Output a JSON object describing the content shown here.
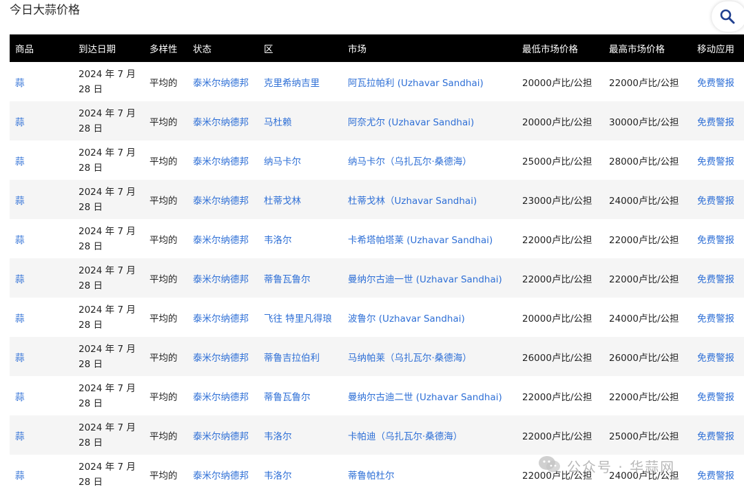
{
  "page": {
    "title": "今日大蒜价格",
    "search_icon": "search-icon"
  },
  "table": {
    "headers": [
      "商品",
      "到达日期",
      "多样性",
      "状态",
      "区",
      "市场",
      "最低市场价格",
      "最高市场价格",
      "移动应用"
    ],
    "rows": [
      {
        "commodity": "蒜",
        "date": "2024 年 7 月 28 日",
        "variety": "平均的",
        "state": "泰米尔纳德邦",
        "district": "克里希纳吉里",
        "market": "阿瓦拉帕利 (Uzhavar Sandhai)",
        "min": "20000卢比/公担",
        "max": "22000卢比/公担",
        "app": "免费警报"
      },
      {
        "commodity": "蒜",
        "date": "2024 年 7 月 28 日",
        "variety": "平均的",
        "state": "泰米尔纳德邦",
        "district": "马杜赖",
        "market": "阿奈尤尔 (Uzhavar Sandhai)",
        "min": "20000卢比/公担",
        "max": "30000卢比/公担",
        "app": "免费警报"
      },
      {
        "commodity": "蒜",
        "date": "2024 年 7 月 28 日",
        "variety": "平均的",
        "state": "泰米尔纳德邦",
        "district": "纳马卡尔",
        "market": "纳马卡尔（乌扎瓦尔·桑德海）",
        "min": "25000卢比/公担",
        "max": "28000卢比/公担",
        "app": "免费警报"
      },
      {
        "commodity": "蒜",
        "date": "2024 年 7 月 28 日",
        "variety": "平均的",
        "state": "泰米尔纳德邦",
        "district": "杜蒂戈林",
        "market": "杜蒂戈林（Uzhavar Sandhai)",
        "min": "23000卢比/公担",
        "max": "24000卢比/公担",
        "app": "免费警报"
      },
      {
        "commodity": "蒜",
        "date": "2024 年 7 月 28 日",
        "variety": "平均的",
        "state": "泰米尔纳德邦",
        "district": "韦洛尔",
        "market": "卡希塔帕塔莱 (Uzhavar Sandhai)",
        "min": "22000卢比/公担",
        "max": "22000卢比/公担",
        "app": "免费警报"
      },
      {
        "commodity": "蒜",
        "date": "2024 年 7 月 28 日",
        "variety": "平均的",
        "state": "泰米尔纳德邦",
        "district": "蒂鲁瓦鲁尔",
        "market": "曼纳尔古迪一世 (Uzhavar Sandhai)",
        "min": "22000卢比/公担",
        "max": "22000卢比/公担",
        "app": "免费警报"
      },
      {
        "commodity": "蒜",
        "date": "2024 年 7 月 28 日",
        "variety": "平均的",
        "state": "泰米尔纳德邦",
        "district": "飞往 特里凡得琅",
        "market": "波鲁尔 (Uzhavar Sandhai)",
        "min": "20000卢比/公担",
        "max": "24000卢比/公担",
        "app": "免费警报"
      },
      {
        "commodity": "蒜",
        "date": "2024 年 7 月 28 日",
        "variety": "平均的",
        "state": "泰米尔纳德邦",
        "district": "蒂鲁吉拉伯利",
        "market": "马纳帕莱（乌扎瓦尔·桑德海）",
        "min": "26000卢比/公担",
        "max": "26000卢比/公担",
        "app": "免费警报"
      },
      {
        "commodity": "蒜",
        "date": "2024 年 7 月 28 日",
        "variety": "平均的",
        "state": "泰米尔纳德邦",
        "district": "蒂鲁瓦鲁尔",
        "market": "曼纳尔古迪二世 (Uzhavar Sandhai)",
        "min": "22000卢比/公担",
        "max": "22000卢比/公担",
        "app": "免费警报"
      },
      {
        "commodity": "蒜",
        "date": "2024 年 7 月 28 日",
        "variety": "平均的",
        "state": "泰米尔纳德邦",
        "district": "韦洛尔",
        "market": "卡帕迪（乌扎瓦尔·桑德海）",
        "min": "22000卢比/公担",
        "max": "25000卢比/公担",
        "app": "免费警报"
      },
      {
        "commodity": "蒜",
        "date": "2024 年 7 月 28 日",
        "variety": "平均的",
        "state": "泰米尔纳德邦",
        "district": "韦洛尔",
        "market": "蒂鲁帕杜尔",
        "min": "22000卢比/公担",
        "max": "24000卢比/公担",
        "app": "免费警报"
      }
    ]
  },
  "watermark": {
    "text": "公众号 · 华蒜网",
    "icon": "wechat-icon"
  },
  "colors": {
    "link": "#2e6fd6",
    "header_bg": "#000000",
    "row_alt": "#f5f5f5"
  }
}
